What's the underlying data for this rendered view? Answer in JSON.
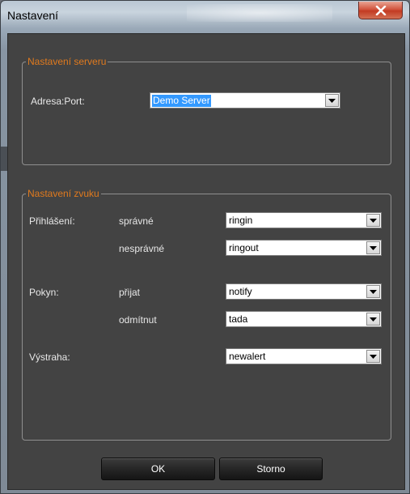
{
  "window": {
    "title": "Nastavení",
    "close_symbol": "X",
    "close_icon": "close-icon"
  },
  "server_group": {
    "legend": "Nastavení serveru",
    "address_label": "Adresa:Port:",
    "address_value": "Demo Server"
  },
  "sound_group": {
    "legend": "Nastavení zvuku",
    "login_label": "Přihlášení:",
    "correct_label": "správné",
    "correct_value": "ringin",
    "incorrect_label": "nesprávné",
    "incorrect_value": "ringout",
    "instruction_label": "Pokyn:",
    "accepted_label": "přijat",
    "accepted_value": "notify",
    "rejected_label": "odmítnut",
    "rejected_value": "tada",
    "warning_label": "Výstraha:",
    "warning_value": "newalert"
  },
  "buttons": {
    "ok": "OK",
    "cancel": "Storno"
  },
  "colors": {
    "legend": "#e07a1e",
    "panel": "#434343",
    "selection": "#3399ff"
  }
}
